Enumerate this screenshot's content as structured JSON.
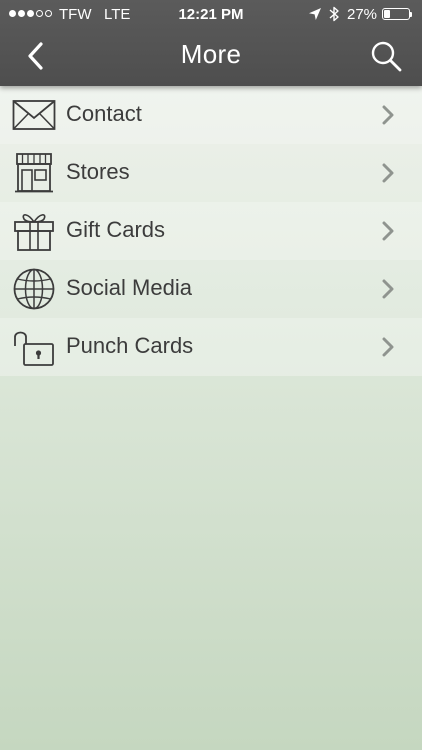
{
  "status_bar": {
    "signal_dots": [
      true,
      true,
      true,
      false,
      false
    ],
    "carrier": "TFW",
    "network": "LTE",
    "time": "12:21 PM",
    "battery_percent_label": "27%",
    "battery_level": 0.27
  },
  "nav": {
    "title": "More",
    "back_icon": "chevron-left-icon",
    "search_icon": "search-icon"
  },
  "menu": {
    "items": [
      {
        "label": "Contact",
        "icon": "envelope-icon"
      },
      {
        "label": "Stores",
        "icon": "storefront-icon"
      },
      {
        "label": "Gift Cards",
        "icon": "gift-icon"
      },
      {
        "label": "Social Media",
        "icon": "globe-icon"
      },
      {
        "label": "Punch Cards",
        "icon": "unlocked-padlock-icon"
      }
    ]
  },
  "colors": {
    "nav_bar": "#555555",
    "icon_stroke": "#3c3c3c",
    "chevron": "#8f948f",
    "background_top": "#eef1ec",
    "background_bottom": "#c5d7c0"
  }
}
